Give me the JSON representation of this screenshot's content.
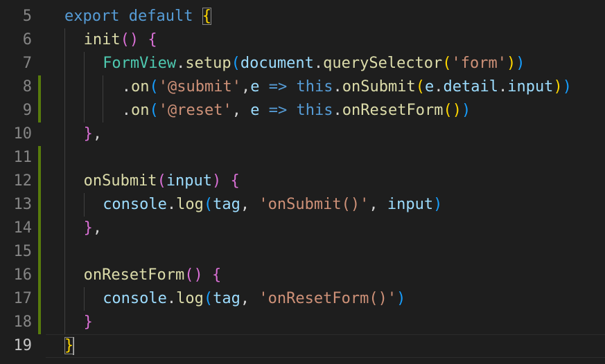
{
  "editor": {
    "colors": {
      "background": "#1e1e1e",
      "line_number": "#858585",
      "line_number_active": "#c6c6c6",
      "modified_gutter": "#587c0c",
      "keyword": "#569cd6",
      "function": "#dcdcaa",
      "class": "#4ec9b0",
      "variable": "#9cdcfe",
      "string": "#ce9178",
      "bracket_level_1": "#ffd700",
      "bracket_level_2": "#da70d6",
      "bracket_level_3": "#179fff"
    },
    "current_line": "19",
    "lines": [
      {
        "num": "5",
        "indent": 0,
        "modified": false,
        "tokens": [
          {
            "t": "export",
            "c": "kw"
          },
          {
            "t": " ",
            "c": "pun"
          },
          {
            "t": "default",
            "c": "kw"
          },
          {
            "t": " ",
            "c": "pun"
          },
          {
            "t": "{",
            "c": "b1m"
          }
        ]
      },
      {
        "num": "6",
        "indent": 1,
        "modified": false,
        "tokens": [
          {
            "t": "init",
            "c": "fn"
          },
          {
            "t": "(",
            "c": "b2"
          },
          {
            "t": ")",
            "c": "b2"
          },
          {
            "t": " ",
            "c": "pun"
          },
          {
            "t": "{",
            "c": "b2"
          }
        ]
      },
      {
        "num": "7",
        "indent": 2,
        "modified": false,
        "tokens": [
          {
            "t": "FormView",
            "c": "cls"
          },
          {
            "t": ".",
            "c": "pun"
          },
          {
            "t": "setup",
            "c": "fn"
          },
          {
            "t": "(",
            "c": "b3"
          },
          {
            "t": "document",
            "c": "var"
          },
          {
            "t": ".",
            "c": "pun"
          },
          {
            "t": "querySelector",
            "c": "fn"
          },
          {
            "t": "(",
            "c": "b1"
          },
          {
            "t": "'form'",
            "c": "str"
          },
          {
            "t": ")",
            "c": "b1"
          },
          {
            "t": ")",
            "c": "b3"
          }
        ]
      },
      {
        "num": "8",
        "indent": 3,
        "modified": true,
        "tokens": [
          {
            "t": ".",
            "c": "pun"
          },
          {
            "t": "on",
            "c": "fn"
          },
          {
            "t": "(",
            "c": "b3"
          },
          {
            "t": "'@submit'",
            "c": "str"
          },
          {
            "t": ",",
            "c": "pun"
          },
          {
            "t": "e",
            "c": "var"
          },
          {
            "t": " ",
            "c": "pun"
          },
          {
            "t": "=>",
            "c": "kw"
          },
          {
            "t": " ",
            "c": "pun"
          },
          {
            "t": "this",
            "c": "kw"
          },
          {
            "t": ".",
            "c": "pun"
          },
          {
            "t": "onSubmit",
            "c": "fn"
          },
          {
            "t": "(",
            "c": "b1"
          },
          {
            "t": "e",
            "c": "var"
          },
          {
            "t": ".",
            "c": "pun"
          },
          {
            "t": "detail",
            "c": "var"
          },
          {
            "t": ".",
            "c": "pun"
          },
          {
            "t": "input",
            "c": "var"
          },
          {
            "t": ")",
            "c": "b1"
          },
          {
            "t": ")",
            "c": "b3"
          }
        ]
      },
      {
        "num": "9",
        "indent": 3,
        "modified": true,
        "tokens": [
          {
            "t": ".",
            "c": "pun"
          },
          {
            "t": "on",
            "c": "fn"
          },
          {
            "t": "(",
            "c": "b3"
          },
          {
            "t": "'@reset'",
            "c": "str"
          },
          {
            "t": ",",
            "c": "pun"
          },
          {
            "t": " ",
            "c": "pun"
          },
          {
            "t": "e",
            "c": "var"
          },
          {
            "t": " ",
            "c": "pun"
          },
          {
            "t": "=>",
            "c": "kw"
          },
          {
            "t": " ",
            "c": "pun"
          },
          {
            "t": "this",
            "c": "kw"
          },
          {
            "t": ".",
            "c": "pun"
          },
          {
            "t": "onResetForm",
            "c": "fn"
          },
          {
            "t": "(",
            "c": "b1"
          },
          {
            "t": ")",
            "c": "b1"
          },
          {
            "t": ")",
            "c": "b3"
          }
        ]
      },
      {
        "num": "10",
        "indent": 1,
        "modified": false,
        "tokens": [
          {
            "t": "}",
            "c": "b2"
          },
          {
            "t": ",",
            "c": "pun"
          }
        ]
      },
      {
        "num": "11",
        "indent": 1,
        "modified": true,
        "tokens": []
      },
      {
        "num": "12",
        "indent": 1,
        "modified": true,
        "tokens": [
          {
            "t": "onSubmit",
            "c": "fn"
          },
          {
            "t": "(",
            "c": "b2"
          },
          {
            "t": "input",
            "c": "var"
          },
          {
            "t": ")",
            "c": "b2"
          },
          {
            "t": " ",
            "c": "pun"
          },
          {
            "t": "{",
            "c": "b2"
          }
        ]
      },
      {
        "num": "13",
        "indent": 2,
        "modified": true,
        "tokens": [
          {
            "t": "console",
            "c": "var"
          },
          {
            "t": ".",
            "c": "pun"
          },
          {
            "t": "log",
            "c": "fn"
          },
          {
            "t": "(",
            "c": "b3"
          },
          {
            "t": "tag",
            "c": "var"
          },
          {
            "t": ",",
            "c": "pun"
          },
          {
            "t": " ",
            "c": "pun"
          },
          {
            "t": "'onSubmit()'",
            "c": "str"
          },
          {
            "t": ",",
            "c": "pun"
          },
          {
            "t": " ",
            "c": "pun"
          },
          {
            "t": "input",
            "c": "var"
          },
          {
            "t": ")",
            "c": "b3"
          }
        ]
      },
      {
        "num": "14",
        "indent": 1,
        "modified": true,
        "tokens": [
          {
            "t": "}",
            "c": "b2"
          },
          {
            "t": ",",
            "c": "pun"
          }
        ]
      },
      {
        "num": "15",
        "indent": 1,
        "modified": true,
        "tokens": []
      },
      {
        "num": "16",
        "indent": 1,
        "modified": true,
        "tokens": [
          {
            "t": "onResetForm",
            "c": "fn"
          },
          {
            "t": "(",
            "c": "b2"
          },
          {
            "t": ")",
            "c": "b2"
          },
          {
            "t": " ",
            "c": "pun"
          },
          {
            "t": "{",
            "c": "b2"
          }
        ]
      },
      {
        "num": "17",
        "indent": 2,
        "modified": true,
        "tokens": [
          {
            "t": "console",
            "c": "var"
          },
          {
            "t": ".",
            "c": "pun"
          },
          {
            "t": "log",
            "c": "fn"
          },
          {
            "t": "(",
            "c": "b3"
          },
          {
            "t": "tag",
            "c": "var"
          },
          {
            "t": ",",
            "c": "pun"
          },
          {
            "t": " ",
            "c": "pun"
          },
          {
            "t": "'onResetForm()'",
            "c": "str"
          },
          {
            "t": ")",
            "c": "b3"
          }
        ]
      },
      {
        "num": "18",
        "indent": 1,
        "modified": true,
        "tokens": [
          {
            "t": "}",
            "c": "b2"
          }
        ]
      },
      {
        "num": "19",
        "indent": 0,
        "modified": false,
        "tokens": [
          {
            "t": "}",
            "c": "b1m"
          },
          {
            "t": "",
            "c": "cursor"
          }
        ]
      }
    ]
  }
}
